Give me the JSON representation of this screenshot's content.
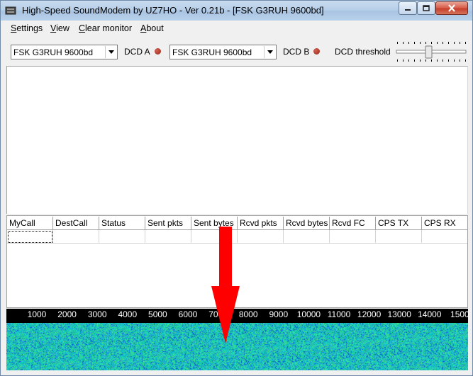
{
  "window": {
    "title": "High-Speed SoundModem by UZ7HO - Ver 0.21b - [FSK G3RUH 9600bd]",
    "icons": {
      "app": "app-icon",
      "minimize": "minimize-icon",
      "maximize": "maximize-icon",
      "close": "close-icon"
    }
  },
  "menu": {
    "items": [
      {
        "accel": "S",
        "rest": "ettings"
      },
      {
        "accel": "V",
        "rest": "iew"
      },
      {
        "accel": "C",
        "rest": "lear monitor"
      },
      {
        "accel": "A",
        "rest": "bout"
      }
    ]
  },
  "toolbar": {
    "modem_a": "FSK G3RUH 9600bd",
    "dcd_a_label": "DCD A",
    "modem_b": "FSK G3RUH 9600bd",
    "dcd_b_label": "DCD B",
    "dcd_threshold_label": "DCD threshold",
    "led_color": "#a02818"
  },
  "table": {
    "columns": [
      "MyCall",
      "DestCall",
      "Status",
      "Sent pkts",
      "Sent bytes",
      "Rcvd pkts",
      "Rcvd bytes",
      "Rcvd FC",
      "CPS TX",
      "CPS RX"
    ]
  },
  "waterfall": {
    "scale_labels": [
      "1000",
      "2000",
      "3000",
      "4000",
      "5000",
      "6000",
      "7000",
      "8000",
      "9000",
      "10000",
      "11000",
      "12000",
      "13000",
      "14000",
      "1500"
    ],
    "annotation": "red-arrow-icon"
  }
}
